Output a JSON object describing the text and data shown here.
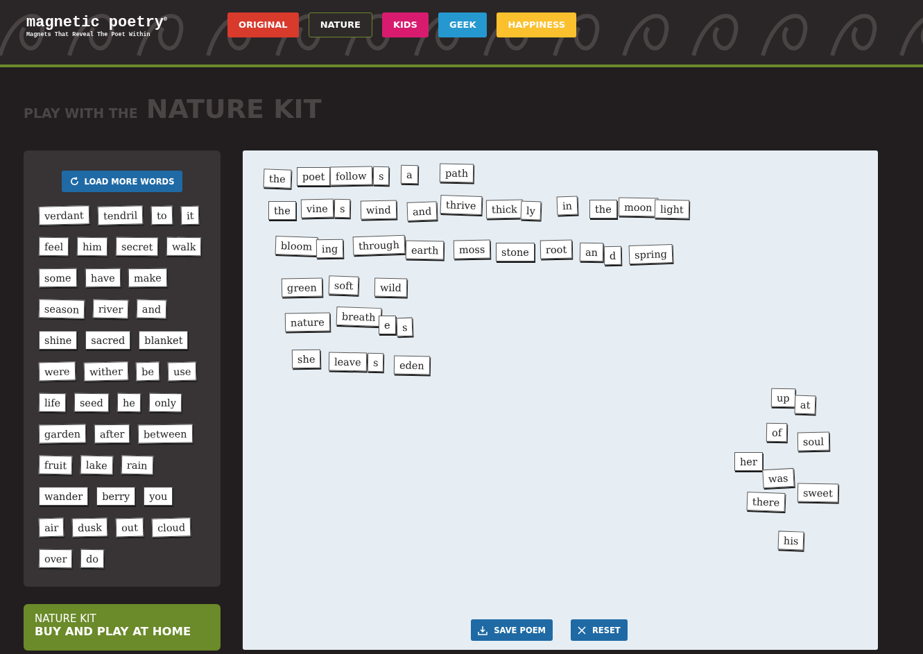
{
  "logo": {
    "name": "magnetic poetry$^{®}$",
    "tagline": "Magnets That Reveal The Poet Within"
  },
  "kits": [
    {
      "label": "ORIGINAL",
      "color": "#d83a2c",
      "selected": false
    },
    {
      "label": "NATURE",
      "color": "#6b8a2a",
      "selected": true
    },
    {
      "label": "KIDS",
      "color": "#d81b6e",
      "selected": false
    },
    {
      "label": "GEEK",
      "color": "#2598cf",
      "selected": false
    },
    {
      "label": "HAPPINESS",
      "color": "#fbc02d",
      "selected": false
    }
  ],
  "heading": {
    "prefix": "PLAY WITH THE",
    "title": "NATURE KIT"
  },
  "word_bank": {
    "button": "LOAD MORE WORDS",
    "rows": [
      [
        "verdant",
        "tendril",
        "to",
        "it"
      ],
      [
        "feel",
        "him",
        "secret",
        "walk"
      ],
      [
        "some",
        "have",
        "make"
      ],
      [
        "season",
        "river",
        "and"
      ],
      [
        "shine",
        "sacred",
        "blanket"
      ],
      [
        "were",
        "wither",
        "be",
        "use"
      ],
      [
        "life",
        "seed",
        "he",
        "only"
      ],
      [
        "garden",
        "after",
        "between"
      ],
      [
        "fruit",
        "lake",
        "rain"
      ],
      [
        "wander",
        "berry",
        "you"
      ],
      [
        "air",
        "dusk",
        "out",
        "cloud"
      ],
      [
        "over",
        "do"
      ]
    ]
  },
  "promo": {
    "line_1": "NATURE KIT",
    "line_2": "BUY AND PLAY AT HOME"
  },
  "board": {
    "magnets": [
      "the",
      "poet",
      "follow",
      "s",
      "a",
      "path",
      "the",
      "vine",
      "s",
      "wind",
      "and",
      "thrive",
      "thick",
      "ly",
      "in",
      "the",
      "moon",
      "light",
      "bloom",
      "ing",
      "through",
      "earth",
      "moss",
      "stone",
      "root",
      "an",
      "d",
      "spring",
      "green",
      "soft",
      "wild",
      "nature",
      "breath",
      "e",
      "s",
      "she",
      "leave",
      "s",
      "eden",
      "up",
      "at",
      "of",
      "soul",
      "her",
      "was",
      "there",
      "sweet",
      "his"
    ],
    "buttons": [
      {
        "kind": "save",
        "label": "SAVE POEM"
      },
      {
        "kind": "reset",
        "label": "RESET"
      }
    ]
  }
}
